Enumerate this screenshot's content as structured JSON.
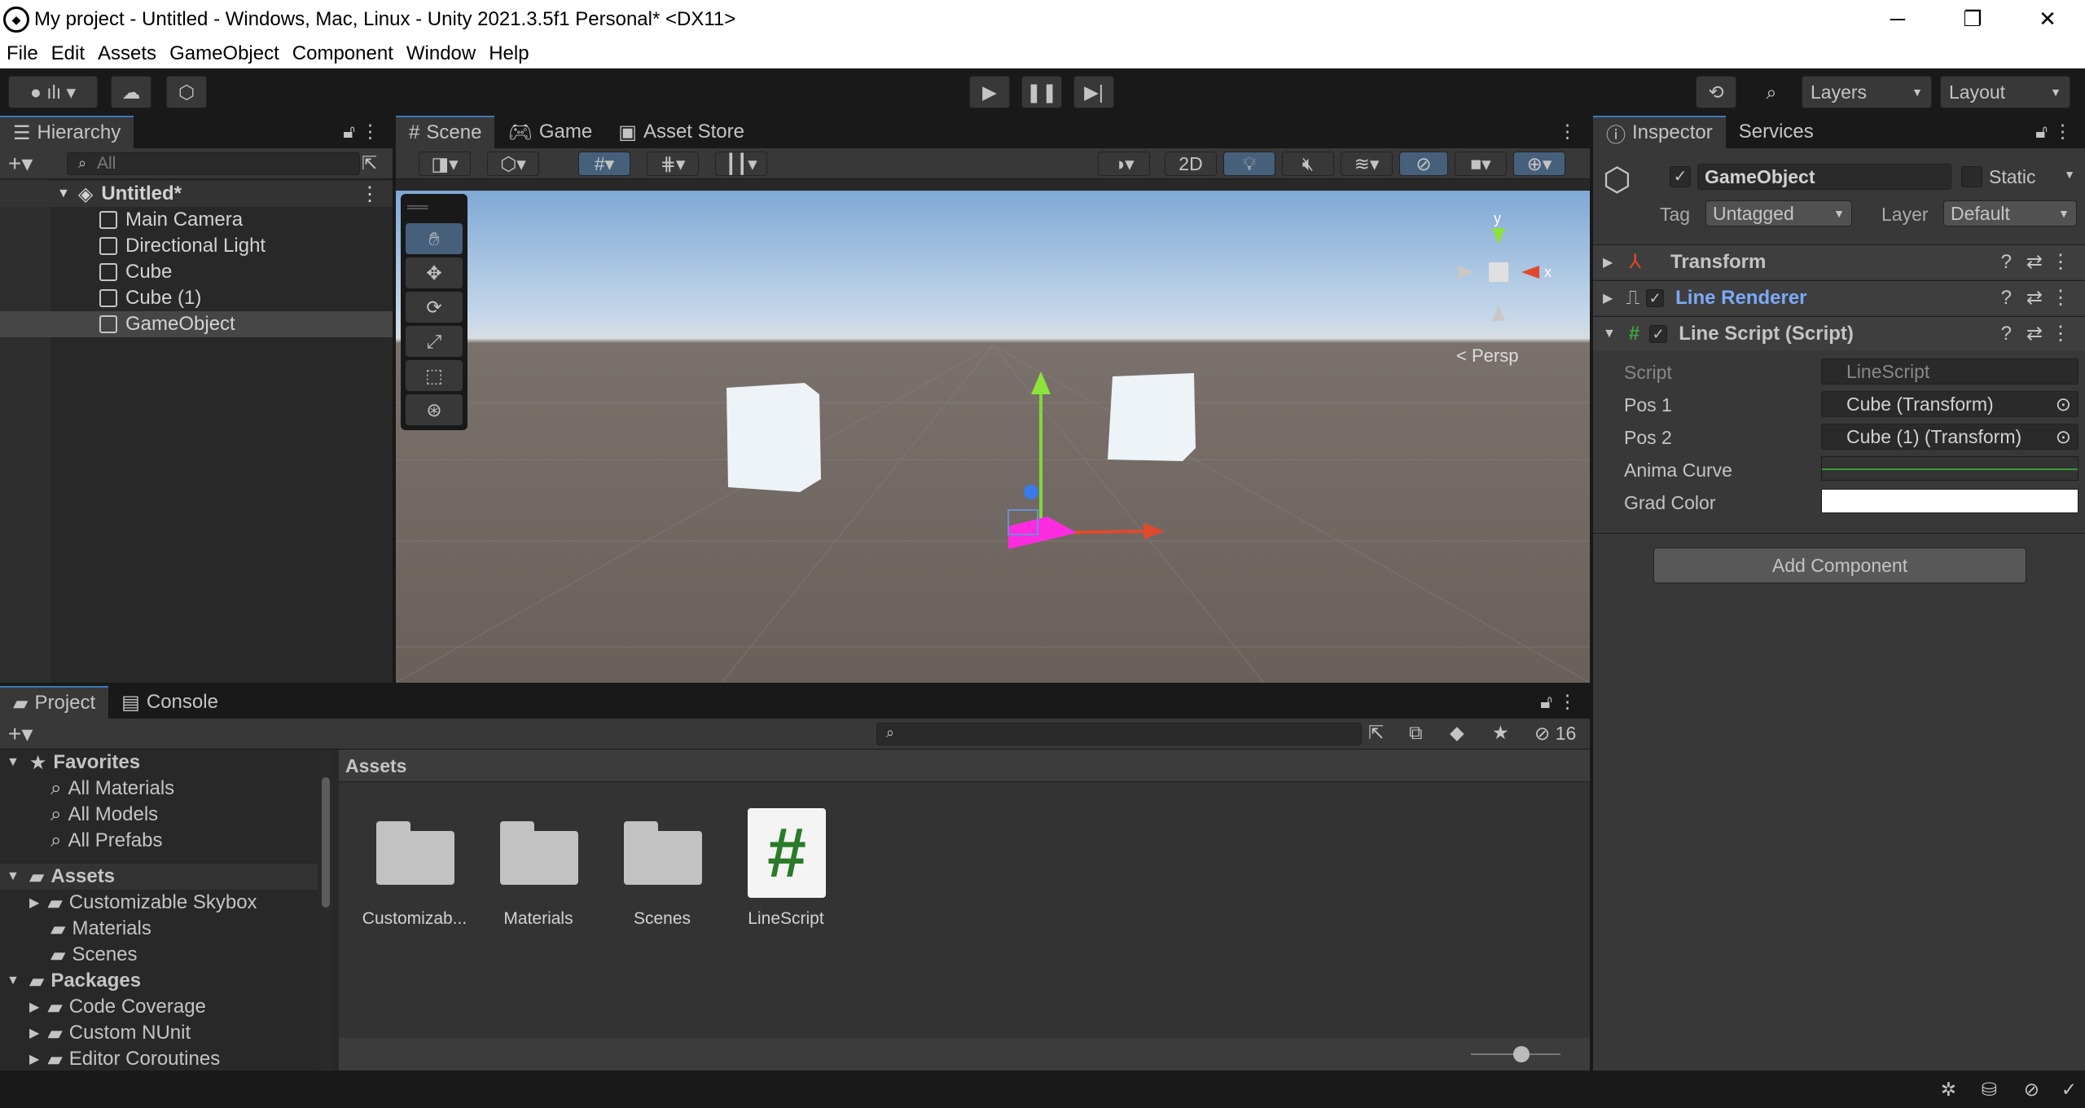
{
  "window": {
    "title": "My project - Untitled - Windows, Mac, Linux - Unity 2021.3.5f1 Personal* <DX11>",
    "minimize": "─",
    "maximize": "❐",
    "close": "✕"
  },
  "menu": [
    "File",
    "Edit",
    "Assets",
    "GameObject",
    "Component",
    "Window",
    "Help"
  ],
  "toolbar": {
    "layers": "Layers",
    "layout": "Layout"
  },
  "hierarchy": {
    "tab": "Hierarchy",
    "search_placeholder": "All",
    "scene": "Untitled*",
    "items": [
      "Main Camera",
      "Directional Light",
      "Cube",
      "Cube (1)",
      "GameObject"
    ]
  },
  "scene_tabs": [
    "Scene",
    "Game",
    "Asset Store"
  ],
  "scene_view": {
    "mode_2d": "2D",
    "persp": "< Persp",
    "axis_y": "y",
    "axis_x": "x"
  },
  "inspector": {
    "tabs": [
      "Inspector",
      "Services"
    ],
    "object_name": "GameObject",
    "static_label": "Static",
    "tag_label": "Tag",
    "tag_value": "Untagged",
    "layer_label": "Layer",
    "layer_value": "Default",
    "components": [
      "Transform",
      "Line Renderer",
      "Line Script (Script)"
    ],
    "fields": [
      {
        "label": "Script",
        "value": "LineScript"
      },
      {
        "label": "Pos 1",
        "value": "Cube (Transform)"
      },
      {
        "label": "Pos 2",
        "value": "Cube (1) (Transform)"
      },
      {
        "label": "Anima Curve",
        "value": ""
      },
      {
        "label": "Grad Color",
        "value": ""
      }
    ],
    "add_component": "Add Component"
  },
  "project": {
    "tabs": [
      "Project",
      "Console"
    ],
    "hidden_count": "16",
    "tree": {
      "favorites": "Favorites",
      "fav_items": [
        "All Materials",
        "All Models",
        "All Prefabs"
      ],
      "assets": "Assets",
      "asset_items": [
        "Customizable Skybox",
        "Materials",
        "Scenes"
      ],
      "packages": "Packages",
      "package_items": [
        "Code Coverage",
        "Custom NUnit",
        "Editor Coroutines"
      ]
    },
    "breadcrumb": "Assets",
    "assets": [
      "Customizab...",
      "Materials",
      "Scenes",
      "LineScript"
    ],
    "script_glyph": "#"
  },
  "colors": {
    "accent": "#3a79bb",
    "link": "#7baaf7",
    "bg": "#282828"
  }
}
